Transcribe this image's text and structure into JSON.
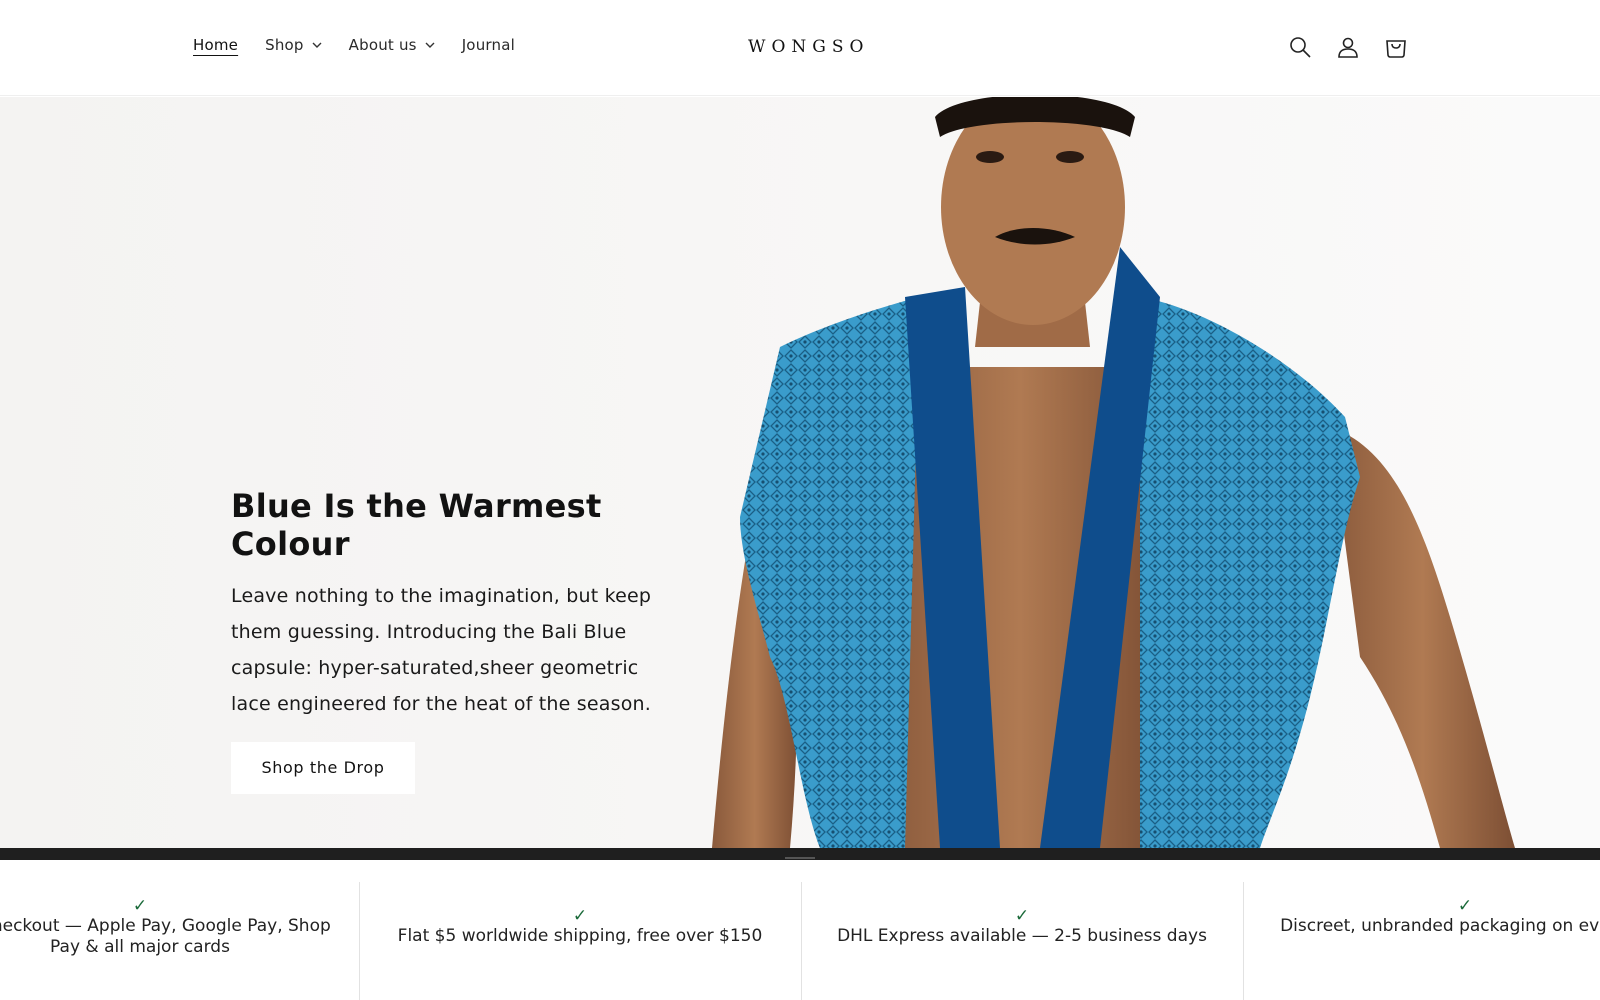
{
  "header": {
    "nav": [
      {
        "label": "Home",
        "active": true,
        "has_dropdown": false
      },
      {
        "label": "Shop",
        "active": false,
        "has_dropdown": true
      },
      {
        "label": "About us",
        "active": false,
        "has_dropdown": true
      },
      {
        "label": "Journal",
        "active": false,
        "has_dropdown": false
      }
    ],
    "logo": "WONGSO",
    "icons": [
      "search-icon",
      "account-icon",
      "cart-icon"
    ]
  },
  "hero": {
    "title": "Blue Is the Warmest Colour",
    "description": "Leave nothing to the imagination, but keep them guessing. Introducing the Bali Blue capsule: hyper-saturated,sheer geometric lace engineered for the heat of the season.",
    "cta_label": "Shop the Drop"
  },
  "benefits": [
    {
      "check": "✓",
      "text": "ure checkout — Apple Pay, Google Pay, Shop Pay & all major cards"
    },
    {
      "check": "✓",
      "text": "Flat $5 worldwide shipping, free over $150"
    },
    {
      "check": "✓",
      "text": "DHL Express available — 2-5 business days"
    },
    {
      "check": "✓",
      "text": "Discreet, unbranded packaging on ev order"
    }
  ],
  "colors": {
    "accent_check": "#1b6a3a",
    "robe_lace": "#2f8fbf",
    "robe_lapel": "#0f4d8c",
    "dark_bar": "#1f1f1f"
  }
}
